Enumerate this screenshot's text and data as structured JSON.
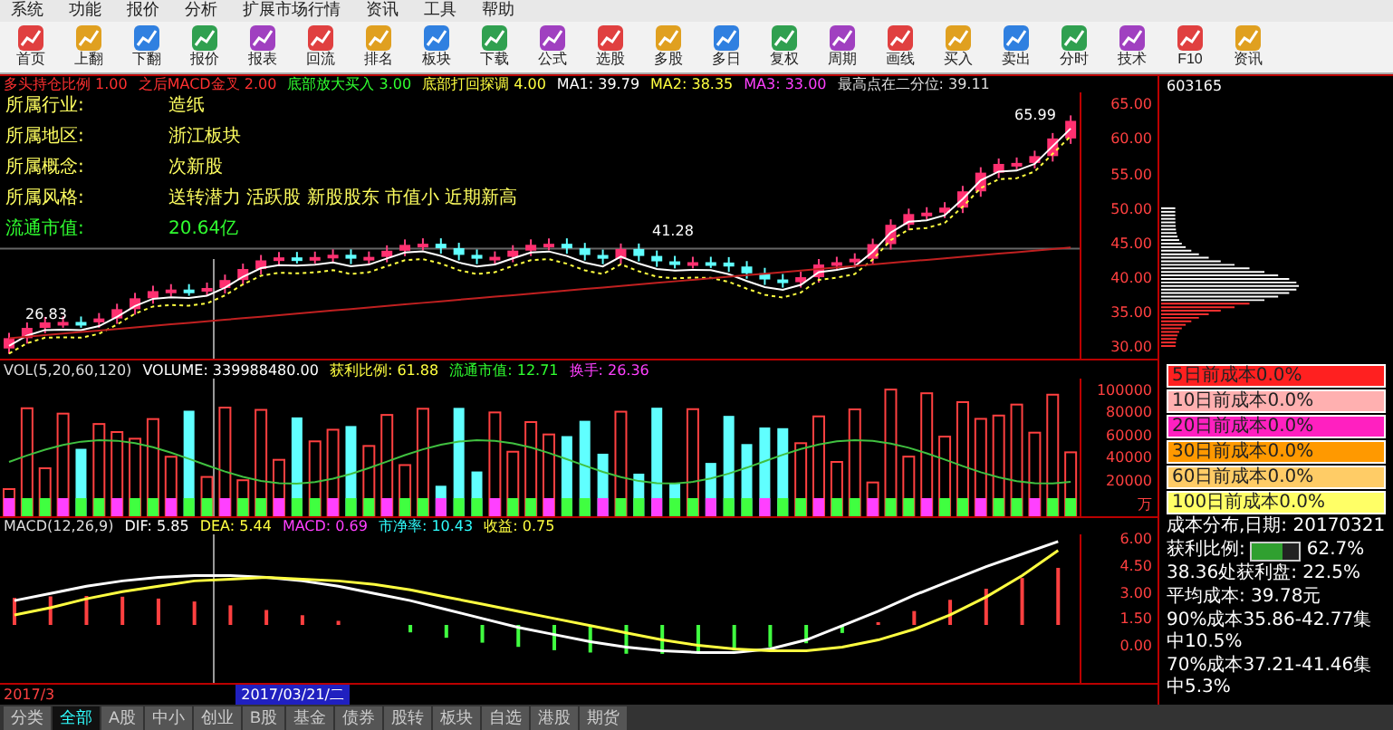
{
  "menu": [
    "系统",
    "功能",
    "报价",
    "分析",
    "扩展市场行情",
    "资讯",
    "工具",
    "帮助"
  ],
  "toolbar": [
    {
      "label": "首页"
    },
    {
      "label": "上翻"
    },
    {
      "label": "下翻"
    },
    {
      "label": "报价"
    },
    {
      "label": "报表"
    },
    {
      "label": "回流"
    },
    {
      "label": "排名"
    },
    {
      "label": "板块"
    },
    {
      "label": "下载"
    },
    {
      "label": "公式"
    },
    {
      "label": "选股"
    },
    {
      "label": "多股"
    },
    {
      "label": "多日"
    },
    {
      "label": "复权"
    },
    {
      "label": "周期"
    },
    {
      "label": "画线"
    },
    {
      "label": "买入"
    },
    {
      "label": "卖出"
    },
    {
      "label": "分时"
    },
    {
      "label": "技术"
    },
    {
      "label": "F10"
    },
    {
      "label": "资讯"
    }
  ],
  "price_panel": {
    "header": [
      {
        "text": "多头持仓比例 1.00",
        "color": "#ff3030"
      },
      {
        "text": "之后MACD金叉 2.00",
        "color": "#ff3030"
      },
      {
        "text": "底部放大买入 3.00",
        "color": "#30ff30"
      },
      {
        "text": "底部打回探调 4.00",
        "color": "#ffff40"
      },
      {
        "text": "MA1: 39.79",
        "color": "#ffffff"
      },
      {
        "text": "MA2: 38.35",
        "color": "#ffff40"
      },
      {
        "text": "MA3: 33.00",
        "color": "#ff40ff"
      },
      {
        "text": "最高点在二分位: 39.11",
        "color": "#dddddd"
      }
    ],
    "info": [
      {
        "label": "所属行业:",
        "value": "造纸"
      },
      {
        "label": "所属地区:",
        "value": "浙江板块"
      },
      {
        "label": "所属概念:",
        "value": "次新股"
      },
      {
        "label": "所属风格:",
        "value": "送转潜力 活跃股 新股股东 市值小 近期新高"
      },
      {
        "label": "流通市值:",
        "value": "20.64亿"
      }
    ],
    "high_label": "65.99",
    "low_label": "26.83",
    "mid_label": "41.28",
    "ticks": [
      "65.00",
      "60.00",
      "55.00",
      "50.00",
      "45.00",
      "40.00",
      "35.00",
      "30.00"
    ]
  },
  "volume_panel": {
    "header": [
      {
        "text": "VOL(5,20,60,120)",
        "color": "#dddddd"
      },
      {
        "text": "VOLUME: 339988480.00",
        "color": "#ffffff"
      },
      {
        "text": "获利比例: 61.88",
        "color": "#ffff40"
      },
      {
        "text": "流通市值: 12.71",
        "color": "#30ff30"
      },
      {
        "text": "换手: 26.36",
        "color": "#ff40ff"
      }
    ],
    "ticks": [
      "100000",
      "80000",
      "60000",
      "40000",
      "20000",
      "万"
    ]
  },
  "macd_panel": {
    "header": [
      {
        "text": "MACD(12,26,9)",
        "color": "#dddddd"
      },
      {
        "kind": "series",
        "value": ": 5.85"
      },
      {
        "kind": "series",
        "value": ": 5.44"
      },
      {
        "text": "MACD: 0.69",
        "color": "#ff40ff"
      },
      {
        "text": "市净率: 10.43",
        "color": "#30ffff"
      },
      {
        "text": "收益: 0.75",
        "color": "#ffff40"
      }
    ],
    "chart_data": {
      "type": "line",
      "ylim": [
        -2,
        6.3
      ],
      "yticks": [
        {
          "value": 6,
          "label": "6.00"
        },
        {
          "value": 4.5,
          "label": "4.50"
        },
        {
          "value": 3,
          "label": "3.00"
        },
        {
          "value": 1.5,
          "label": "1.50"
        },
        {
          "value": 0,
          "label": "0.00"
        }
      ],
      "series": [
        {
          "name": "DIF",
          "color": "#ffffff",
          "values": [
            2.6,
            3.0,
            3.4,
            3.7,
            3.9,
            4.0,
            4.0,
            3.9,
            3.7,
            3.4,
            3.0,
            2.6,
            2.1,
            1.6,
            1.1,
            0.7,
            0.3,
            0.0,
            -0.2,
            -0.3,
            -0.3,
            -0.1,
            0.4,
            1.2,
            2.0,
            2.9,
            3.7,
            4.5,
            5.2,
            5.9
          ]
        },
        {
          "name": "DEA",
          "color": "#ffff40",
          "values": [
            1.8,
            2.2,
            2.7,
            3.1,
            3.4,
            3.7,
            3.8,
            3.9,
            3.8,
            3.7,
            3.5,
            3.2,
            2.8,
            2.4,
            2.0,
            1.6,
            1.2,
            0.8,
            0.4,
            0.1,
            -0.1,
            -0.2,
            -0.2,
            0.0,
            0.4,
            1.0,
            1.8,
            2.8,
            4.0,
            5.4
          ]
        }
      ]
    }
  },
  "stock_code": "603165",
  "chips": {
    "legend": [
      {
        "label": "5日前成本0.0%",
        "color": "#ff2020"
      },
      {
        "label": "10日前成本0.0%",
        "color": "#ffb0b0"
      },
      {
        "label": "20日前成本0.0%",
        "color": "#ff20c0"
      },
      {
        "label": "30日前成本0.0%",
        "color": "#ff9900"
      },
      {
        "label": "60日前成本0.0%",
        "color": "#ffcc66"
      },
      {
        "label": "100日前成本0.0%",
        "color": "#ffff66"
      }
    ],
    "date_line": "成本分布,日期: 20170321",
    "profit_label": "获利比例:",
    "profit_value": "62.7%",
    "level": 0.627,
    "stats": [
      "38.36处获利盘: 22.5%",
      "平均成本: 39.78元",
      "90%成本35.86-42.77集中10.5%",
      "70%成本37.21-41.46集中5.3%"
    ]
  },
  "time_axis": {
    "start": "2017/3",
    "cursor": "2017/03/21/二"
  },
  "market_tabs": [
    {
      "label": "分类",
      "selected": false
    },
    {
      "label": "全部",
      "selected": true
    },
    {
      "label": "A股",
      "selected": false
    },
    {
      "label": "中小",
      "selected": false
    },
    {
      "label": "创业",
      "selected": false
    },
    {
      "label": "B股",
      "selected": false
    },
    {
      "label": "基金",
      "selected": false
    },
    {
      "label": "债券",
      "selected": false
    },
    {
      "label": "股转",
      "selected": false
    },
    {
      "label": "板块",
      "selected": false
    },
    {
      "label": "自选",
      "selected": false
    },
    {
      "label": "港股",
      "selected": false
    },
    {
      "label": "期货",
      "selected": false
    }
  ]
}
